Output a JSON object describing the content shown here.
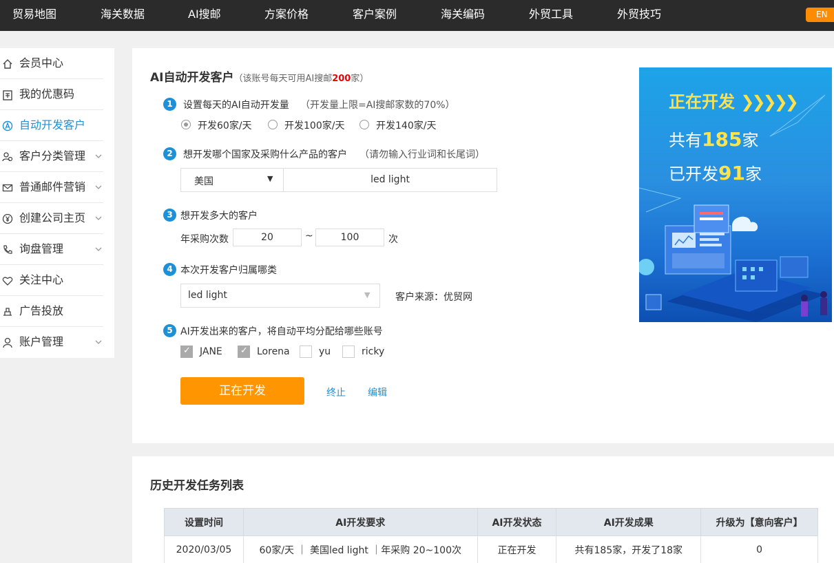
{
  "topnav": {
    "items": [
      "贸易地图",
      "海关数据",
      "AI搜邮",
      "方案价格",
      "客户案例",
      "海关编码",
      "外贸工具",
      "外贸技巧"
    ],
    "lang": "EN"
  },
  "sidebar": {
    "items": [
      {
        "label": "会员中心",
        "icon": "home-icon"
      },
      {
        "label": "我的优惠码",
        "icon": "coupon-icon"
      },
      {
        "label": "自动开发客户",
        "icon": "ai-icon"
      },
      {
        "label": "客户分类管理",
        "icon": "customers-icon"
      },
      {
        "label": "普通邮件营销",
        "icon": "mail-icon"
      },
      {
        "label": "创建公司主页",
        "icon": "yen-icon"
      },
      {
        "label": "询盘管理",
        "icon": "phone-icon"
      },
      {
        "label": "关注中心",
        "icon": "heart-icon"
      },
      {
        "label": "广告投放",
        "icon": "ad-icon"
      },
      {
        "label": "账户管理",
        "icon": "user-icon"
      }
    ],
    "active_index": 2
  },
  "form": {
    "title": "AI自动开发客户",
    "title_note_pre": "（该账号每天可用AI搜邮",
    "title_note_num": "200",
    "title_note_post": "家）",
    "step1": {
      "num": "1",
      "text": "设置每天的AI自动开发量",
      "note": "（开发量上限=AI搜邮家数的70%）",
      "options": [
        "开发60家/天",
        "开发100家/天",
        "开发140家/天"
      ],
      "selected": "开发60家/天"
    },
    "step2": {
      "num": "2",
      "text": "想开发哪个国家及采购什么产品的客户",
      "note": "（请勿输入行业词和长尾词）",
      "country": "美国",
      "product": "led light"
    },
    "step3": {
      "num": "3",
      "text": "想开发多大的客户",
      "label": "年采购次数",
      "min": "20",
      "sep": "~",
      "max": "100",
      "unit": "次"
    },
    "step4": {
      "num": "4",
      "text": "本次开发客户归属哪类",
      "category": "led light",
      "source": "客户来源：优贸网"
    },
    "step5": {
      "num": "5",
      "text": "AI开发出来的客户，将自动平均分配给哪些账号",
      "accounts": [
        {
          "name": "JANE",
          "checked": true
        },
        {
          "name": "Lorena",
          "checked": true
        },
        {
          "name": "yu",
          "checked": false
        },
        {
          "name": "ricky",
          "checked": false
        }
      ]
    },
    "primary_button": "正在开发",
    "stop_link": "终止",
    "edit_link": "编辑"
  },
  "banner": {
    "headline": "正在开发",
    "total_pre": "共有",
    "total_num": "185",
    "total_post": "家",
    "done_pre": "已开发",
    "done_num": "91",
    "done_post": "家"
  },
  "history": {
    "title": "历史开发任务列表",
    "columns": [
      "设置时间",
      "AI开发要求",
      "AI开发状态",
      "AI开发成果",
      "升级为【意向客户】"
    ],
    "rows": [
      [
        "2020/03/05",
        "60家/天 ｜ 美国led light ｜年采购 20~100次",
        "正在开发",
        "共有185家，开发了18家",
        "0"
      ]
    ]
  }
}
